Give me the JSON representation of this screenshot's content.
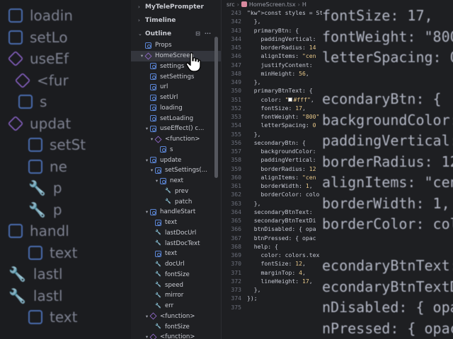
{
  "bg_left": {
    "rows": [
      {
        "icon": "var",
        "text": "loadin"
      },
      {
        "icon": "var",
        "text": "setLo"
      },
      {
        "icon": "func",
        "text": "useEf"
      },
      {
        "icon": "func",
        "text": "<fur"
      },
      {
        "icon": "var",
        "text": "s"
      },
      {
        "icon": "func",
        "text": "updat"
      },
      {
        "icon": "var",
        "text": "setSt"
      },
      {
        "icon": "var",
        "text": "ne"
      },
      {
        "icon": "wrench",
        "text": "p"
      },
      {
        "icon": "wrench",
        "text": "p"
      },
      {
        "icon": "var",
        "text": "handl"
      },
      {
        "icon": "var",
        "text": "text"
      },
      {
        "icon": "wrench",
        "text": "lastl"
      },
      {
        "icon": "wrench",
        "text": "lastl"
      },
      {
        "icon": "var",
        "text": "text"
      }
    ]
  },
  "bg_right": {
    "lines": [
      "fontSize: 17,",
      "fontWeight: \"800",
      "letterSpacing: 0",
      "",
      "econdaryBtn: {",
      "backgroundColor:",
      "paddingVertical:",
      "borderRadius: 12",
      "alignItems: \"cen",
      "borderWidth: 1,",
      "borderColor: col",
      "",
      "econdaryBtnText:",
      "econdaryBtnTextDi",
      "nDisabled: { opa",
      "nPressed: { opac"
    ]
  },
  "sidebar": {
    "sections": {
      "project": "MyTelePrompter",
      "timeline": "Timeline",
      "outline": "Outline"
    },
    "outline_tools": {
      "collapse": "⊟",
      "more": "···"
    },
    "tree": [
      {
        "depth": 1,
        "icon": "var",
        "label": "Props",
        "toggle": ""
      },
      {
        "depth": 1,
        "icon": "func",
        "label": "HomeScreen",
        "toggle": "▾",
        "selected": true
      },
      {
        "depth": 2,
        "icon": "var",
        "label": "settings",
        "toggle": ""
      },
      {
        "depth": 2,
        "icon": "var",
        "label": "setSettings",
        "toggle": ""
      },
      {
        "depth": 2,
        "icon": "var",
        "label": "url",
        "toggle": ""
      },
      {
        "depth": 2,
        "icon": "var",
        "label": "setUrl",
        "toggle": ""
      },
      {
        "depth": 2,
        "icon": "var",
        "label": "loading",
        "toggle": ""
      },
      {
        "depth": 2,
        "icon": "var",
        "label": "setLoading",
        "toggle": ""
      },
      {
        "depth": 2,
        "icon": "var",
        "label": "useEffect() c...",
        "toggle": "▾"
      },
      {
        "depth": 3,
        "icon": "func",
        "label": "<function>",
        "toggle": "▾"
      },
      {
        "depth": 4,
        "icon": "var",
        "label": "s",
        "toggle": ""
      },
      {
        "depth": 2,
        "icon": "var",
        "label": "update",
        "toggle": "▾"
      },
      {
        "depth": 3,
        "icon": "var",
        "label": "setSettings(...",
        "toggle": "▾"
      },
      {
        "depth": 4,
        "icon": "var",
        "label": "next",
        "toggle": "▾"
      },
      {
        "depth": 5,
        "icon": "wrench",
        "label": "prev",
        "toggle": ""
      },
      {
        "depth": 5,
        "icon": "wrench",
        "label": "patch",
        "toggle": ""
      },
      {
        "depth": 2,
        "icon": "var",
        "label": "handleStart",
        "toggle": "▾"
      },
      {
        "depth": 3,
        "icon": "var",
        "label": "text",
        "toggle": ""
      },
      {
        "depth": 3,
        "icon": "wrench",
        "label": "lastDocUrl",
        "toggle": ""
      },
      {
        "depth": 3,
        "icon": "wrench",
        "label": "lastDocText",
        "toggle": ""
      },
      {
        "depth": 3,
        "icon": "var",
        "label": "text",
        "toggle": ""
      },
      {
        "depth": 3,
        "icon": "wrench",
        "label": "docUrl",
        "toggle": ""
      },
      {
        "depth": 3,
        "icon": "wrench",
        "label": "fontSize",
        "toggle": ""
      },
      {
        "depth": 3,
        "icon": "wrench",
        "label": "speed",
        "toggle": ""
      },
      {
        "depth": 3,
        "icon": "wrench",
        "label": "mirror",
        "toggle": ""
      },
      {
        "depth": 3,
        "icon": "wrench",
        "label": "err",
        "toggle": ""
      },
      {
        "depth": 2,
        "icon": "func",
        "label": "<function>",
        "toggle": "▾"
      },
      {
        "depth": 3,
        "icon": "wrench",
        "label": "fontSize",
        "toggle": ""
      },
      {
        "depth": 2,
        "icon": "func",
        "label": "<function>",
        "toggle": "▾"
      }
    ]
  },
  "editor": {
    "breadcrumb": [
      "src",
      "HomeScreen.tsx",
      "H"
    ],
    "lines": [
      {
        "n": "243",
        "code": "const styles = Style"
      },
      {
        "n": "342",
        "code": "  },"
      },
      {
        "n": "343",
        "code": "  primaryBtn: {"
      },
      {
        "n": "344",
        "code": "    paddingVertical:"
      },
      {
        "n": "345",
        "code": "    borderRadius: 14"
      },
      {
        "n": "346",
        "code": "    alignItems: \"cen"
      },
      {
        "n": "347",
        "code": "    justifyContent: "
      },
      {
        "n": "348",
        "code": "    minHeight: 56,"
      },
      {
        "n": "349",
        "code": "  },"
      },
      {
        "n": "350",
        "code": "  primaryBtnText: {"
      },
      {
        "n": "351",
        "code": "    color: \"■#fff\","
      },
      {
        "n": "352",
        "code": "    fontSize: 17,"
      },
      {
        "n": "353",
        "code": "    fontWeight: \"800\""
      },
      {
        "n": "354",
        "code": "    letterSpacing: 0"
      },
      {
        "n": "355",
        "code": "  },"
      },
      {
        "n": "356",
        "code": "  secondaryBtn: {"
      },
      {
        "n": "357",
        "code": "    backgroundColor:"
      },
      {
        "n": "358",
        "code": "    paddingVertical:"
      },
      {
        "n": "359",
        "code": "    borderRadius: 12"
      },
      {
        "n": "360",
        "code": "    alignItems: \"cen"
      },
      {
        "n": "361",
        "code": "    borderWidth: 1,"
      },
      {
        "n": "362",
        "code": "    borderColor: colo"
      },
      {
        "n": "363",
        "code": "  },"
      },
      {
        "n": "364",
        "code": "  secondaryBtnText:"
      },
      {
        "n": "365",
        "code": "  secondaryBtnTextDi"
      },
      {
        "n": "366",
        "code": "  btnDisabled: { opa"
      },
      {
        "n": "367",
        "code": "  btnPressed: { opac"
      },
      {
        "n": "368",
        "code": "  help: {"
      },
      {
        "n": "369",
        "code": "    color: colors.tex"
      },
      {
        "n": "370",
        "code": "    fontSize: 12,"
      },
      {
        "n": "371",
        "code": "    marginTop: 4,"
      },
      {
        "n": "372",
        "code": "    lineHeight: 17,"
      },
      {
        "n": "373",
        "code": "  },"
      },
      {
        "n": "374",
        "code": "});"
      },
      {
        "n": "375",
        "code": ""
      }
    ]
  },
  "colors": {
    "sidebar_bg": "#1f2023",
    "editor_bg": "#1e1f22",
    "variable_icon": "#5b86d6",
    "function_icon": "#9b6fd8",
    "selected_row": "#34363d"
  }
}
